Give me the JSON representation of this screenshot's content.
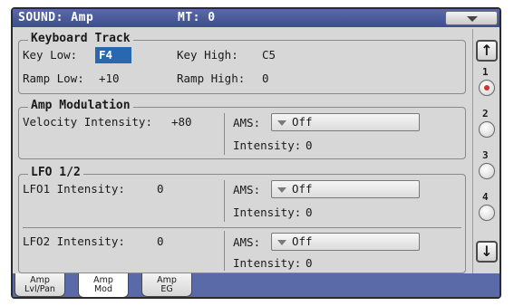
{
  "titlebar": {
    "title": "SOUND: Amp",
    "mt": "MT: 0"
  },
  "keyboard_track": {
    "title": "Keyboard Track",
    "key_low_label": "Key Low:",
    "key_low_value": "F4",
    "key_high_label": "Key High:",
    "key_high_value": "C5",
    "ramp_low_label": "Ramp Low:",
    "ramp_low_value": "+10",
    "ramp_high_label": "Ramp High:",
    "ramp_high_value": "0"
  },
  "amp_modulation": {
    "title": "Amp Modulation",
    "velocity_label": "Velocity Intensity:",
    "velocity_value": "+80",
    "ams_label": "AMS:",
    "ams_value": "Off",
    "intensity_label": "Intensity:",
    "intensity_value": "0"
  },
  "lfo": {
    "title": "LFO 1/2",
    "lfo1_label": "LFO1 Intensity:",
    "lfo1_value": "0",
    "lfo1_ams_label": "AMS:",
    "lfo1_ams_value": "Off",
    "lfo1_intensity_label": "Intensity:",
    "lfo1_intensity_value": "0",
    "lfo2_label": "LFO2 Intensity:",
    "lfo2_value": "0",
    "lfo2_ams_label": "AMS:",
    "lfo2_ams_value": "Off",
    "lfo2_intensity_label": "Intensity:",
    "lfo2_intensity_value": "0"
  },
  "pages": {
    "up_icon": "arrow-up-icon",
    "down_icon": "arrow-down-icon",
    "numbers": [
      "1",
      "2",
      "3",
      "4"
    ],
    "active": "1"
  },
  "tabs": [
    {
      "line1": "Amp",
      "line2": "Lvl/Pan"
    },
    {
      "line1": "Amp",
      "line2": "Mod"
    },
    {
      "line1": "Amp",
      "line2": "EG"
    }
  ],
  "colors": {
    "title_bar": "#4a5a9c",
    "selected_value": "#2768b0",
    "active_page_dot": "#d43030"
  }
}
